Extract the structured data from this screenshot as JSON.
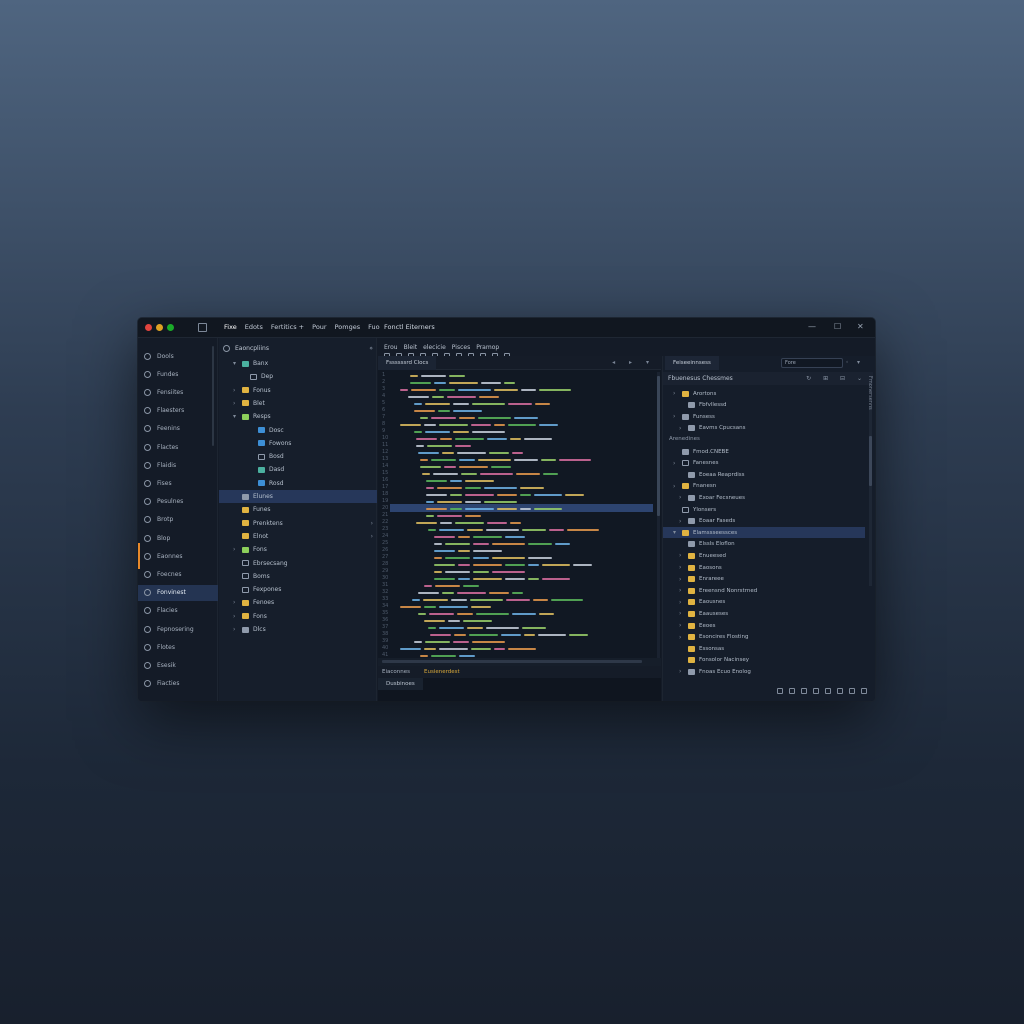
{
  "menu": [
    "Fixe",
    "Edots",
    "Fertitics +",
    "Pour",
    "Pomges",
    "Fuo"
  ],
  "document_title": "Fonctl Eiterners",
  "toolbar": {
    "labels": [
      "Erou",
      "Bleit",
      "elecicie",
      "Pisces",
      "Pramop"
    ]
  },
  "window_controls": [
    "—",
    "☐",
    "✕"
  ],
  "activity": [
    {
      "label": "Dools"
    },
    {
      "label": "Fundes"
    },
    {
      "label": "Fensiites"
    },
    {
      "label": "Flaesters"
    },
    {
      "label": "Feenins"
    },
    {
      "label": "Flactes"
    },
    {
      "label": "Flaidis"
    },
    {
      "label": "Fises"
    },
    {
      "label": "Pesulnes"
    },
    {
      "label": "Brotp"
    },
    {
      "label": "Blop"
    },
    {
      "label": "Eaonnes"
    },
    {
      "label": "Foecnes"
    },
    {
      "label": "Fonvinest"
    },
    {
      "label": "Flacies"
    },
    {
      "label": "Fepnosering"
    },
    {
      "label": "Flotes"
    },
    {
      "label": "Esesik"
    },
    {
      "label": "Fiacties"
    }
  ],
  "explorer": {
    "title": "Eaoncpliins",
    "items": [
      {
        "label": "Banx",
        "arrow": "▾",
        "icon": "f-teal",
        "indent": 1
      },
      {
        "label": "Dep",
        "arrow": "",
        "icon": "f-outline",
        "indent": 2
      },
      {
        "label": "Fonus",
        "arrow": "›",
        "icon": "f-yellow",
        "indent": 1
      },
      {
        "label": "Blet",
        "arrow": "›",
        "icon": "f-yellow",
        "indent": 1
      },
      {
        "label": "Resps",
        "arrow": "▾",
        "icon": "f-green",
        "indent": 1
      },
      {
        "label": "Dosc",
        "arrow": "",
        "icon": "f-blue",
        "indent": 3
      },
      {
        "label": "Fowons",
        "arrow": "",
        "icon": "f-blue",
        "indent": 3
      },
      {
        "label": "Bosd",
        "arrow": "",
        "icon": "f-outline",
        "indent": 3
      },
      {
        "label": "Dasd",
        "arrow": "",
        "icon": "f-teal",
        "indent": 3
      },
      {
        "label": "Rosd",
        "arrow": "",
        "icon": "f-blue",
        "indent": 3
      },
      {
        "label": "Elunes",
        "arrow": "",
        "icon": "f-gray",
        "indent": 1,
        "selected": true
      },
      {
        "label": "Funes",
        "arrow": "",
        "icon": "f-yellow",
        "indent": 1
      },
      {
        "label": "Prenktens",
        "arrow": "",
        "icon": "f-yellow",
        "indent": 1,
        "chev": true
      },
      {
        "label": "Elnot",
        "arrow": "",
        "icon": "f-yellow",
        "indent": 1,
        "chev": true
      },
      {
        "label": "Fons",
        "arrow": "›",
        "icon": "f-green",
        "indent": 1
      },
      {
        "label": "Ebrsecsang",
        "arrow": "",
        "icon": "f-outline",
        "indent": 1
      },
      {
        "label": "Boms",
        "arrow": "",
        "icon": "f-outline",
        "indent": 1
      },
      {
        "label": "Fexpones",
        "arrow": "",
        "icon": "f-outline",
        "indent": 1
      },
      {
        "label": "Fenoes",
        "arrow": "›",
        "icon": "f-yellow",
        "indent": 1
      },
      {
        "label": "Fons",
        "arrow": "›",
        "icon": "f-yellow",
        "indent": 1
      },
      {
        "label": "Dlcs",
        "arrow": "›",
        "icon": "f-gray",
        "indent": 1
      }
    ]
  },
  "editor": {
    "tab": "Fssssssrd Clocs",
    "line_numbers": [
      "1",
      "2",
      "3",
      "4",
      "5",
      "6",
      "7",
      "8",
      "9",
      "10",
      "11",
      "12",
      "13",
      "14",
      "15",
      "16",
      "17",
      "18",
      "19",
      "20",
      "21",
      "22",
      "23",
      "24",
      "25",
      "26",
      "27",
      "28",
      "29",
      "30",
      "31",
      "32",
      "33",
      "34",
      "35",
      "36",
      "37",
      "38",
      "39",
      "40",
      "41",
      "42"
    ],
    "status_left": "Eiaconnes",
    "status_right": "Eusienerdest",
    "bottom_tab": "Dusbinoes"
  },
  "right": {
    "tab": "Feiseeinnsess",
    "search_value": "Fore",
    "header": "Fbuenesus Chessmes",
    "items": [
      {
        "type": "item",
        "label": "Arortons",
        "arrow": "›",
        "icon": "f-yellow",
        "indent": 1
      },
      {
        "type": "item",
        "label": "Fbfvllessd",
        "arrow": "",
        "icon": "f-gray",
        "indent": 2
      },
      {
        "type": "item",
        "label": "Funsess",
        "arrow": "›",
        "icon": "f-gray",
        "indent": 1
      },
      {
        "type": "item",
        "label": "Eavms Cpucsans",
        "arrow": "›",
        "icon": "f-gray",
        "indent": 2
      },
      {
        "type": "section",
        "label": "Arenedines"
      },
      {
        "type": "item",
        "label": "Fmod.CNEBE",
        "arrow": "",
        "icon": "f-gray",
        "indent": 1
      },
      {
        "type": "item",
        "label": "Fanesnes",
        "arrow": "›",
        "icon": "f-outline",
        "indent": 1
      },
      {
        "type": "item",
        "label": "Eoeaa Reaprdiss",
        "arrow": "",
        "icon": "f-gray",
        "indent": 2
      },
      {
        "type": "item",
        "label": "Fnanesn",
        "arrow": "›",
        "icon": "f-yellow",
        "indent": 1
      },
      {
        "type": "item",
        "label": "Exoar Fecsneues",
        "arrow": "›",
        "icon": "f-gray",
        "indent": 2
      },
      {
        "type": "item",
        "label": "Ylonsers",
        "arrow": "",
        "icon": "f-outline",
        "indent": 1
      },
      {
        "type": "item",
        "label": "Eoaar Faseds",
        "arrow": "›",
        "icon": "f-gray",
        "indent": 2
      },
      {
        "type": "item",
        "label": "Elamssseessces",
        "arrow": "▾",
        "icon": "f-yellow",
        "indent": 1,
        "selected": true
      },
      {
        "type": "item",
        "label": "Elssls Eloflon",
        "arrow": "",
        "icon": "f-gray",
        "indent": 2
      },
      {
        "type": "item",
        "label": "Enueesed",
        "arrow": "›",
        "icon": "f-yellow",
        "indent": 2
      },
      {
        "type": "item",
        "label": "Eaosons",
        "arrow": "›",
        "icon": "f-yellow",
        "indent": 2
      },
      {
        "type": "item",
        "label": "Enrareee",
        "arrow": "›",
        "icon": "f-yellow",
        "indent": 2
      },
      {
        "type": "item",
        "label": "Ereensnd Nonrstrned",
        "arrow": "›",
        "icon": "f-yellow",
        "indent": 2
      },
      {
        "type": "item",
        "label": "Eaousnes",
        "arrow": "›",
        "icon": "f-yellow",
        "indent": 2
      },
      {
        "type": "item",
        "label": "Eaauseses",
        "arrow": "›",
        "icon": "f-yellow",
        "indent": 2
      },
      {
        "type": "item",
        "label": "Eeoes",
        "arrow": "›",
        "icon": "f-yellow",
        "indent": 2
      },
      {
        "type": "item",
        "label": "Esoncires Flosting",
        "arrow": "›",
        "icon": "f-yellow",
        "indent": 2
      },
      {
        "type": "item",
        "label": "Essonsas",
        "arrow": "",
        "icon": "f-yellow",
        "indent": 2
      },
      {
        "type": "item",
        "label": "Fonsolor Nacinsey",
        "arrow": "",
        "icon": "f-yellow",
        "indent": 2
      },
      {
        "type": "item",
        "label": "Fnoas Ecuo Enolog",
        "arrow": "›",
        "icon": "f-gray",
        "indent": 2
      }
    ],
    "vertical_label": "Fmonersenns"
  },
  "colors": {
    "accent": "#e8892a",
    "selection": "#26375a",
    "highlight_line": "#2d4470"
  }
}
